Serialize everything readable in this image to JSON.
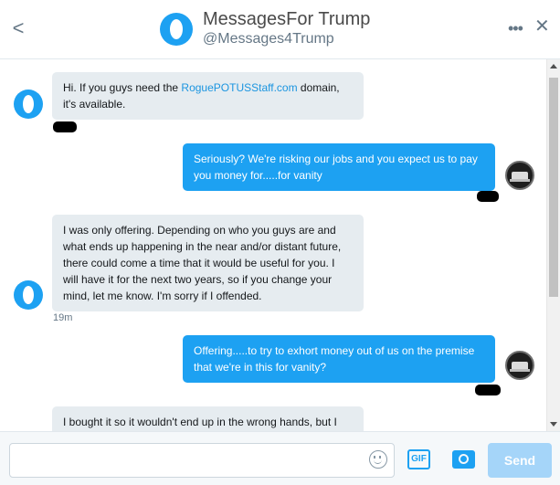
{
  "header": {
    "back_label": "<",
    "name": "MessagesFor Trump",
    "handle": "@Messages4Trump",
    "more_label": "•••",
    "close_label": "✕"
  },
  "messages": [
    {
      "direction": "in",
      "text_before": "Hi. If you guys need the ",
      "link": "RoguePOTUSStaff.com",
      "text_after": " domain, it's available."
    },
    {
      "direction": "out",
      "text": "Seriously? We're risking our jobs and you expect us to pay you money for.....for vanity"
    },
    {
      "direction": "in",
      "text": "I was only offering. Depending on who you guys are and what ends up happening in the near and/or distant future, there could come a time that it would be useful for you. I will have it for the next two years, so if you change your mind, let me know. I'm sorry if I offended.",
      "timestamp": "19m"
    },
    {
      "direction": "out",
      "text": "Offering.....to try to exhort money out of us on the premise that we're in this for vanity?"
    },
    {
      "direction": "in",
      "text": "I bought it so it wouldn't end up in the wrong hands, but I"
    }
  ],
  "composer": {
    "placeholder": "",
    "gif_label": "GIF",
    "send_label": "Send"
  },
  "icons": {
    "emoji": "emoji-icon",
    "camera": "camera-icon"
  },
  "colors": {
    "accent": "#1da1f2",
    "incoming_bubble": "#e6ecf0",
    "send_disabled": "#a5d5f9"
  }
}
